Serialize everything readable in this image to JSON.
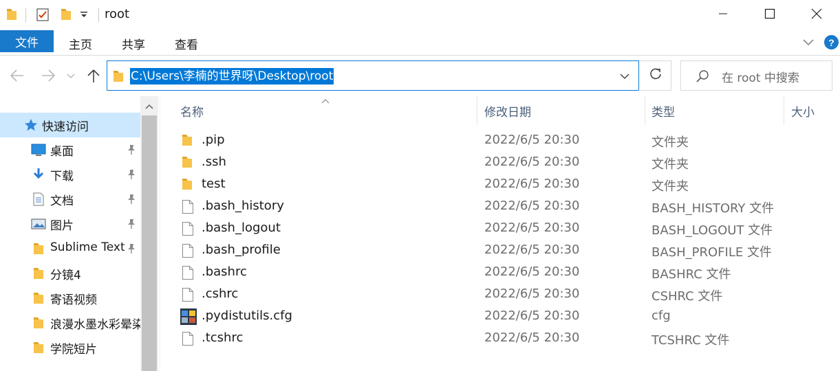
{
  "window": {
    "title": "root",
    "minimize_icon": "minimize-icon",
    "maximize_icon": "maximize-icon",
    "close_icon": "close-icon"
  },
  "ribbon": {
    "tabs": [
      {
        "label": "文件",
        "active": true
      },
      {
        "label": "主页"
      },
      {
        "label": "共享"
      },
      {
        "label": "查看"
      }
    ],
    "help_label": "?"
  },
  "address": {
    "path": "C:\\Users\\李楠的世界呀\\Desktop\\root"
  },
  "search": {
    "placeholder": "在 root 中搜索"
  },
  "nav": {
    "items": [
      {
        "label": "快速访问",
        "icon": "star-icon",
        "selected": true
      },
      {
        "label": "桌面",
        "icon": "desktop-icon",
        "pinned": true
      },
      {
        "label": "下载",
        "icon": "download-icon",
        "pinned": true
      },
      {
        "label": "文档",
        "icon": "document-icon",
        "pinned": true
      },
      {
        "label": "图片",
        "icon": "picture-icon",
        "pinned": true
      },
      {
        "label": "Sublime Text",
        "icon": "folder-icon",
        "pinned": true
      },
      {
        "label": "分镜4",
        "icon": "folder-icon"
      },
      {
        "label": "寄语视频",
        "icon": "folder-icon"
      },
      {
        "label": "浪漫水墨水彩晕染",
        "icon": "folder-icon"
      },
      {
        "label": "学院短片",
        "icon": "folder-icon"
      }
    ]
  },
  "columns": {
    "name": "名称",
    "modified": "修改日期",
    "type": "类型",
    "size": "大小"
  },
  "files": [
    {
      "name": ".pip",
      "date": "2022/6/5 20:30",
      "type": "文件夹",
      "icon": "folder-icon"
    },
    {
      "name": ".ssh",
      "date": "2022/6/5 20:30",
      "type": "文件夹",
      "icon": "folder-icon"
    },
    {
      "name": "test",
      "date": "2022/6/5 20:30",
      "type": "文件夹",
      "icon": "folder-icon"
    },
    {
      "name": ".bash_history",
      "date": "2022/6/5 20:30",
      "type": "BASH_HISTORY 文件",
      "icon": "file-icon"
    },
    {
      "name": ".bash_logout",
      "date": "2022/6/5 20:30",
      "type": "BASH_LOGOUT 文件",
      "icon": "file-icon"
    },
    {
      "name": ".bash_profile",
      "date": "2022/6/5 20:30",
      "type": "BASH_PROFILE 文件",
      "icon": "file-icon"
    },
    {
      "name": ".bashrc",
      "date": "2022/6/5 20:30",
      "type": "BASHRC 文件",
      "icon": "file-icon"
    },
    {
      "name": ".cshrc",
      "date": "2022/6/5 20:30",
      "type": "CSHRC 文件",
      "icon": "file-icon"
    },
    {
      "name": ".pydistutils.cfg",
      "date": "2022/6/5 20:30",
      "type": "cfg",
      "icon": "cfg-file-icon"
    },
    {
      "name": ".tcshrc",
      "date": "2022/6/5 20:30",
      "type": "TCSHRC 文件",
      "icon": "file-icon"
    }
  ],
  "colors": {
    "accent": "#0078d7",
    "file_tab": "#1979ca",
    "folder": "#f8c34a",
    "selection": "#cce8ff"
  }
}
